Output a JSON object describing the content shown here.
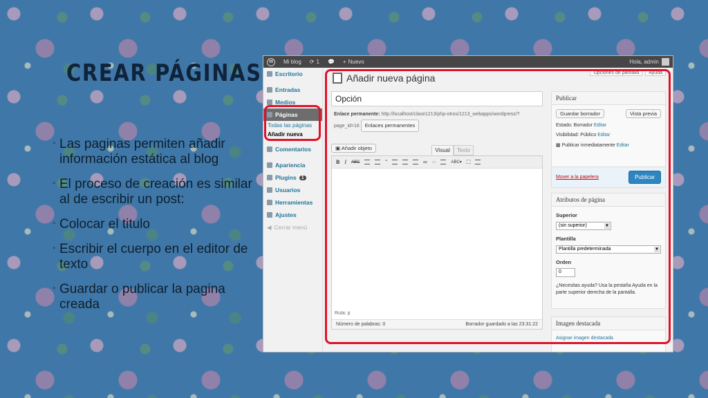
{
  "slide": {
    "title": "CREAR PÁGINAS",
    "bullets": [
      "Las paginas permiten añadir información estática al blog",
      "El proceso de creación es similar al de escribir un post:",
      "Colocar el titulo",
      "Escribir el cuerpo en el editor de texto",
      "Guardar o publicar la pagina creada"
    ]
  },
  "adminbar": {
    "site": "Mi blog",
    "updates": "1",
    "new": "Nuevo",
    "greeting": "Hola, admin"
  },
  "sidebar": {
    "dashboard": "Escritorio",
    "posts": "Entradas",
    "media": "Medios",
    "pages": "Páginas",
    "sub_all": "Todas las páginas",
    "sub_new": "Añadir nueva",
    "comments": "Comentarios",
    "appearance": "Apariencia",
    "plugins": "Plugins",
    "plugins_badge": "1",
    "users": "Usuarios",
    "tools": "Herramientas",
    "settings": "Ajustes",
    "collapse": "Cerrar menú"
  },
  "top_buttons": {
    "screen_options": "Opciones de pantalla",
    "help": "Ayuda"
  },
  "editor": {
    "heading": "Añadir nueva página",
    "title_value": "Opción",
    "permalink_label": "Enlace permanente:",
    "permalink_url": "http://localhost/clase1213/php-otros/1213_webapps/wordpress/?page_id=18",
    "permalink_button": "Enlaces permanentes",
    "add_media": "Añadir objeto",
    "tab_visual": "Visual",
    "tab_text": "Texto",
    "path": "Ruta: p",
    "word_count": "Número de palabras: 0",
    "draft_saved": "Borrador guardado a las 23:31:22"
  },
  "publish_box": {
    "title": "Publicar",
    "save_draft": "Guardar borrador",
    "preview": "Vista previa",
    "status": "Estado: Borrador",
    "visibility": "Visibilidad: Público",
    "publish_when": "Publicar inmediatamente",
    "edit": "Editar",
    "trash": "Mover a la papelera",
    "publish": "Publicar"
  },
  "attributes_box": {
    "title": "Atributos de página",
    "parent_label": "Superior",
    "parent_value": "(sin superior)",
    "template_label": "Plantilla",
    "template_value": "Plantilla predeterminada",
    "order_label": "Orden",
    "order_value": "0",
    "help_text": "¿Necesitas ayuda? Usa la pestaña Ayuda en la parte superior derecha de la pantalla."
  },
  "featured_box": {
    "title": "Imagen destacada",
    "link": "Asignar imagen destacada"
  },
  "colors": {
    "highlight": "#e0102a",
    "link": "#21759b",
    "publish": "#2e85c0"
  }
}
